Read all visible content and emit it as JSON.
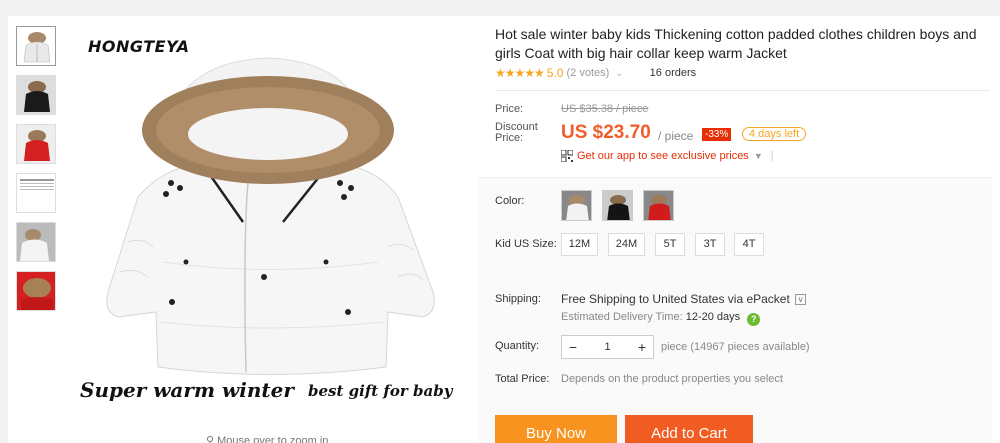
{
  "product": {
    "brand": "HONGTEYA",
    "image_caption_left": "Super warm winter",
    "image_caption_right": "best gift for baby",
    "zoom_hint": "Mouse over to zoom in",
    "title": "Hot sale winter baby kids Thickening cotton padded clothes children boys and girls Coat with big hair collar keep warm Jacket",
    "stars": "★★★★★",
    "rating": "5.0",
    "votes": "(2 votes)",
    "votes_chevron": "⌄",
    "orders": "16 orders"
  },
  "pricing": {
    "price_label": "Price:",
    "original_price": "US $35.38 / piece",
    "discount_label_line1": "Discount",
    "discount_label_line2": "Price:",
    "discount_price": "US $23.70",
    "unit": "/ piece",
    "discount_badge": "-33%",
    "days_left": "4 days left",
    "app_promo": "Get our app to see exclusive prices",
    "app_promo_arrow": "▼",
    "app_promo_sep": "|"
  },
  "options": {
    "color_label": "Color:",
    "colors": [
      "white",
      "black",
      "red"
    ],
    "size_label": "Kid US Size:",
    "sizes": [
      "12M",
      "24M",
      "5T",
      "3T",
      "4T"
    ]
  },
  "shipping": {
    "label": "Shipping:",
    "free": "Free Shipping to",
    "destination": "United States via ePacket",
    "dropdown": "v",
    "est_label": "Estimated Delivery Time:",
    "est_days": "12-20 days",
    "help": "?"
  },
  "quantity": {
    "label": "Quantity:",
    "minus": "−",
    "plus": "+",
    "value": "1",
    "note": "piece (14967 pieces available)"
  },
  "total": {
    "label": "Total Price:",
    "note": "Depends on the product properties you select"
  },
  "actions": {
    "buy_now": "Buy Now",
    "add_to_cart": "Add to Cart"
  },
  "colors": {
    "price": "#f15c2a",
    "stars": "#f5a623",
    "badge": "#e62e04",
    "buy_now": "#f7931e",
    "add_to_cart": "#f15c22"
  }
}
